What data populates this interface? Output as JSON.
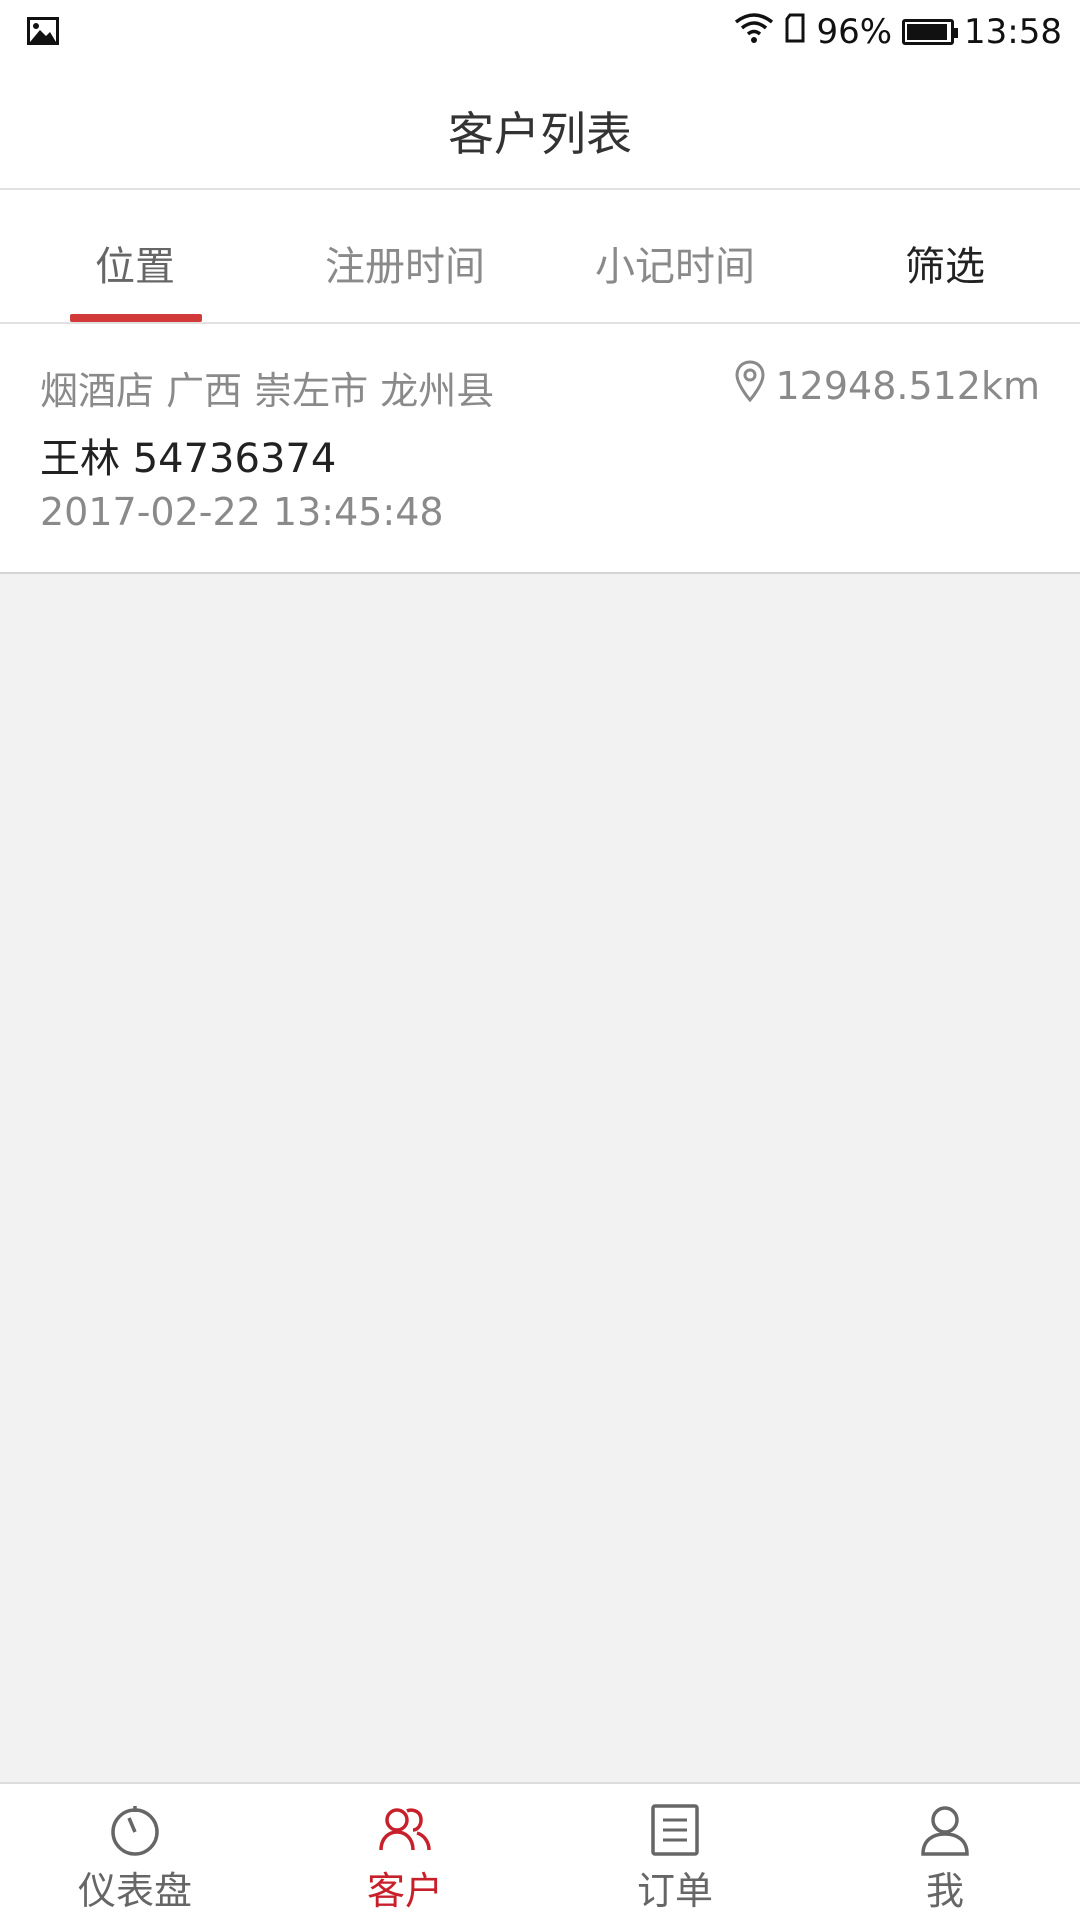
{
  "status_bar": {
    "left_icon": "image-icon",
    "wifi_icon": "wifi-icon",
    "sim_icon": "sim-icon",
    "battery_percent": "96%",
    "battery_level": 0.96,
    "time": "13:58"
  },
  "header": {
    "title": "客户列表"
  },
  "tabs": [
    {
      "label": "位置",
      "active": true
    },
    {
      "label": "注册时间",
      "active": false
    },
    {
      "label": "小记时间",
      "active": false
    },
    {
      "label": "筛选",
      "active": false
    }
  ],
  "customers": [
    {
      "address": "烟酒店 广西 崇左市 龙州县",
      "distance": "12948.512km",
      "name_phone": "王林 54736374",
      "date": "2017-02-22 13:45:48"
    }
  ],
  "bottom_nav": [
    {
      "label": "仪表盘",
      "icon": "dashboard-icon",
      "active": false
    },
    {
      "label": "客户",
      "icon": "customers-icon",
      "active": true
    },
    {
      "label": "订单",
      "icon": "orders-icon",
      "active": false
    },
    {
      "label": "我",
      "icon": "profile-icon",
      "active": false
    }
  ],
  "colors": {
    "accent": "#c8202a",
    "tab_underline": "#d23a3a",
    "background": "#f2f2f2"
  }
}
